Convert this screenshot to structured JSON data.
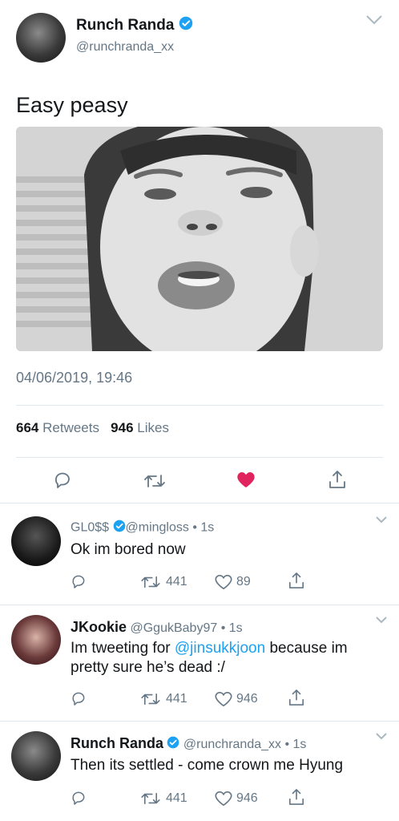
{
  "main_tweet": {
    "display_name": "Runch Randa",
    "handle": "@runchranda_xx",
    "text": "Easy peasy",
    "timestamp": "04/06/2019, 19:46",
    "retweet_count": "664",
    "retweet_label": "Retweets",
    "like_count": "946",
    "like_label": "Likes",
    "liked": true
  },
  "replies": [
    {
      "display_name": "GL0$$",
      "handle": "@mingloss",
      "time": "• 1s",
      "text": "Ok im bored now",
      "retweets": "441",
      "likes": "89"
    },
    {
      "display_name": "JKookie",
      "handle": "@GgukBaby97",
      "time": "• 1s",
      "text_before": "Im tweeting for ",
      "mention": "@jinsukkjoon",
      "text_after": " because im pretty sure he’s dead :/",
      "retweets": "441",
      "likes": "946"
    },
    {
      "display_name": "Runch Randa",
      "handle": "@runchranda_xx",
      "time": "• 1s",
      "text": "Then its settled - come crown me Hyung",
      "retweets": "441",
      "likes": "946"
    }
  ],
  "colors": {
    "verified": "#1da1f2",
    "like_active": "#e0245e",
    "muted": "#657786"
  },
  "icons": [
    "chevron-down-icon",
    "verified-badge-icon",
    "reply-icon",
    "retweet-icon",
    "heart-icon",
    "share-icon"
  ]
}
